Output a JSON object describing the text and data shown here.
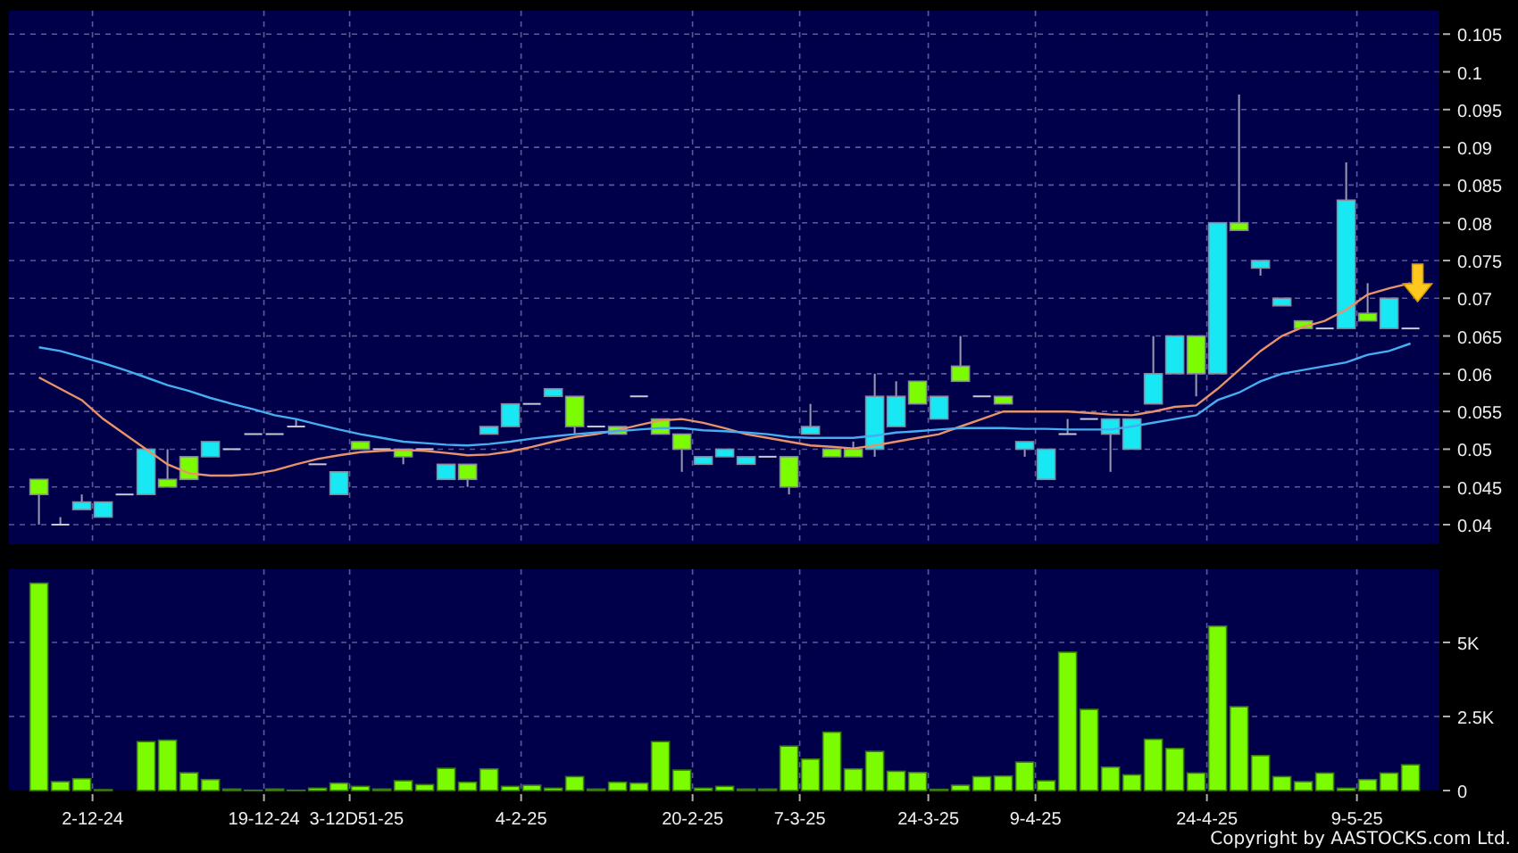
{
  "price_chart": {
    "chart_data": {
      "type": "candlestick",
      "grid": true,
      "categories": [
        null,
        null,
        null,
        null,
        null,
        null,
        null,
        null,
        null,
        null,
        null,
        null,
        null,
        null,
        null,
        null,
        null,
        null,
        null,
        null,
        null,
        null,
        null,
        null,
        null,
        null,
        null,
        null,
        null,
        null,
        null,
        null,
        null,
        null,
        null,
        null,
        null,
        null,
        null,
        null,
        null,
        null,
        null,
        null,
        null,
        null,
        null,
        null,
        null,
        null,
        null,
        null,
        null,
        null,
        null,
        null,
        null,
        null,
        null,
        null,
        null,
        null,
        null,
        null,
        null
      ],
      "ylim": [
        0.0374,
        0.1081
      ],
      "yticks": [
        0.04,
        0.045,
        0.05,
        0.055,
        0.06,
        0.065,
        0.07,
        0.075,
        0.08,
        0.085,
        0.09,
        0.095,
        0.1,
        0.105
      ],
      "series": [
        {
          "type": "line",
          "color": "#e8926a",
          "values": [
            0.0595,
            0.058,
            0.0565,
            0.054,
            0.052,
            0.05,
            0.048,
            0.0468,
            0.0465,
            0.0465,
            0.0467,
            0.0472,
            0.048,
            0.0487,
            0.0492,
            0.0496,
            0.0498,
            0.0499,
            0.0498,
            0.0495,
            0.0492,
            0.0493,
            0.0497,
            0.0503,
            0.051,
            0.0516,
            0.052,
            0.0525,
            0.0532,
            0.0538,
            0.054,
            0.0535,
            0.0528,
            0.052,
            0.0515,
            0.051,
            0.0505,
            0.0503,
            0.0501,
            0.0505,
            0.051,
            0.0515,
            0.052,
            0.053,
            0.054,
            0.055,
            0.055,
            0.055,
            0.055,
            0.0548,
            0.0546,
            0.0545,
            0.055,
            0.0556,
            0.0558,
            0.058,
            0.0605,
            0.063,
            0.065,
            0.0662,
            0.067,
            0.0685,
            0.0705,
            0.0713,
            0.072
          ]
        },
        {
          "type": "line",
          "color": "#46aef0",
          "values": [
            0.0635,
            0.063,
            0.0622,
            0.0614,
            0.0605,
            0.0595,
            0.0585,
            0.0577,
            0.0568,
            0.056,
            0.0553,
            0.0545,
            0.054,
            0.0533,
            0.0526,
            0.052,
            0.0515,
            0.051,
            0.0508,
            0.0506,
            0.0505,
            0.0507,
            0.051,
            0.0514,
            0.0517,
            0.052,
            0.0522,
            0.0524,
            0.0526,
            0.0528,
            0.0528,
            0.0525,
            0.0524,
            0.0522,
            0.052,
            0.0516,
            0.0515,
            0.0515,
            0.0515,
            0.0518,
            0.0522,
            0.0524,
            0.0526,
            0.0528,
            0.0528,
            0.0528,
            0.0527,
            0.0527,
            0.0526,
            0.0526,
            0.0526,
            0.053,
            0.0535,
            0.054,
            0.0545,
            0.0565,
            0.0575,
            0.059,
            0.06,
            0.0605,
            0.061,
            0.0615,
            0.0625,
            0.063,
            0.064
          ]
        }
      ],
      "ohlc": [
        [
          0.046,
          0.046,
          0.04,
          0.044
        ],
        [
          0.04,
          0.041,
          0.04,
          0.04
        ],
        [
          0.042,
          0.044,
          0.042,
          0.043
        ],
        [
          0.041,
          0.043,
          0.041,
          0.043
        ],
        [
          0.044,
          0.044,
          0.044,
          0.044
        ],
        [
          0.044,
          0.05,
          0.044,
          0.05
        ],
        [
          0.046,
          0.05,
          0.045,
          0.045
        ],
        [
          0.049,
          0.049,
          0.046,
          0.046
        ],
        [
          0.049,
          0.051,
          0.049,
          0.051
        ],
        [
          0.05,
          0.05,
          0.05,
          0.05
        ],
        [
          0.052,
          0.052,
          0.052,
          0.052
        ],
        [
          0.052,
          0.052,
          0.052,
          0.052
        ],
        [
          0.053,
          0.054,
          0.053,
          0.053
        ],
        [
          0.048,
          0.048,
          0.048,
          0.048
        ],
        [
          0.044,
          0.047,
          0.044,
          0.047
        ],
        [
          0.051,
          0.051,
          0.05,
          0.05
        ],
        [
          0.05,
          0.05,
          0.05,
          0.05
        ],
        [
          0.05,
          0.05,
          0.048,
          0.049
        ],
        [
          0.05,
          0.05,
          0.05,
          0.05
        ],
        [
          0.046,
          0.048,
          0.046,
          0.048
        ],
        [
          0.048,
          0.048,
          0.045,
          0.046
        ],
        [
          0.052,
          0.053,
          0.052,
          0.053
        ],
        [
          0.053,
          0.056,
          0.053,
          0.056
        ],
        [
          0.056,
          0.056,
          0.056,
          0.056
        ],
        [
          0.057,
          0.058,
          0.057,
          0.058
        ],
        [
          0.057,
          0.057,
          0.052,
          0.053
        ],
        [
          0.053,
          0.053,
          0.053,
          0.053
        ],
        [
          0.053,
          0.053,
          0.052,
          0.052
        ],
        [
          0.057,
          0.057,
          0.057,
          0.057
        ],
        [
          0.054,
          0.054,
          0.052,
          0.052
        ],
        [
          0.052,
          0.052,
          0.047,
          0.05
        ],
        [
          0.048,
          0.049,
          0.048,
          0.049
        ],
        [
          0.049,
          0.05,
          0.049,
          0.05
        ],
        [
          0.048,
          0.049,
          0.048,
          0.049
        ],
        [
          0.049,
          0.049,
          0.049,
          0.049
        ],
        [
          0.049,
          0.049,
          0.044,
          0.045
        ],
        [
          0.052,
          0.056,
          0.052,
          0.053
        ],
        [
          0.05,
          0.05,
          0.049,
          0.049
        ],
        [
          0.05,
          0.051,
          0.049,
          0.049
        ],
        [
          0.05,
          0.06,
          0.049,
          0.057
        ],
        [
          0.053,
          0.059,
          0.053,
          0.057
        ],
        [
          0.059,
          0.059,
          0.056,
          0.056
        ],
        [
          0.054,
          0.057,
          0.054,
          0.057
        ],
        [
          0.061,
          0.065,
          0.059,
          0.059
        ],
        [
          0.057,
          0.057,
          0.057,
          0.057
        ],
        [
          0.057,
          0.057,
          0.056,
          0.056
        ],
        [
          0.05,
          0.051,
          0.049,
          0.051
        ],
        [
          0.046,
          0.05,
          0.046,
          0.05
        ],
        [
          0.052,
          0.054,
          0.052,
          0.052
        ],
        [
          0.054,
          0.054,
          0.054,
          0.054
        ],
        [
          0.052,
          0.054,
          0.047,
          0.054
        ],
        [
          0.05,
          0.054,
          0.05,
          0.054
        ],
        [
          0.056,
          0.065,
          0.056,
          0.06
        ],
        [
          0.06,
          0.065,
          0.06,
          0.065
        ],
        [
          0.065,
          0.065,
          0.057,
          0.06
        ],
        [
          0.06,
          0.08,
          0.06,
          0.08
        ],
        [
          0.08,
          0.097,
          0.079,
          0.079
        ],
        [
          0.074,
          0.075,
          0.073,
          0.075
        ],
        [
          0.069,
          0.07,
          0.069,
          0.07
        ],
        [
          0.067,
          0.067,
          0.066,
          0.066
        ],
        [
          0.066,
          0.066,
          0.066,
          0.066
        ],
        [
          0.066,
          0.088,
          0.066,
          0.083
        ],
        [
          0.068,
          0.072,
          0.067,
          0.067
        ],
        [
          0.066,
          0.07,
          0.066,
          0.07
        ],
        [
          0.066,
          0.066,
          0.066,
          0.066
        ]
      ]
    }
  },
  "volume_chart": {
    "chart_data": {
      "type": "bar",
      "grid": true,
      "ylim": [
        0,
        7470
      ],
      "categories": [
        null,
        null,
        "2-12-24",
        null,
        null,
        null,
        null,
        null,
        null,
        null,
        "19-12-24",
        null,
        null,
        null,
        "3-12D51-25",
        null,
        null,
        null,
        null,
        null,
        null,
        null,
        "4-2-25",
        null,
        null,
        null,
        null,
        null,
        null,
        null,
        "20-2-25",
        null,
        null,
        null,
        null,
        "7-3-25",
        null,
        null,
        null,
        null,
        null,
        "24-3-25",
        null,
        null,
        null,
        null,
        "9-4-25",
        null,
        null,
        null,
        null,
        null,
        null,
        null,
        "24-4-25",
        null,
        null,
        null,
        null,
        null,
        null,
        "9-5-25",
        null,
        null,
        null
      ],
      "yticks": [
        {
          "value": 0,
          "label": "0"
        },
        {
          "value": 2500,
          "label": "2.5K"
        },
        {
          "value": 5000,
          "label": "5K"
        }
      ],
      "series": [
        {
          "color": "#7cfc00",
          "values": [
            7000,
            300,
            400,
            30,
            0,
            1650,
            1700,
            600,
            370,
            50,
            10,
            50,
            10,
            80,
            250,
            140,
            50,
            330,
            200,
            750,
            280,
            730,
            140,
            180,
            80,
            470,
            50,
            280,
            250,
            1650,
            690,
            80,
            140,
            50,
            50,
            1500,
            1060,
            1970,
            730,
            1320,
            650,
            610,
            40,
            180,
            470,
            490,
            960,
            330,
            4670,
            2740,
            790,
            530,
            1730,
            1420,
            590,
            5550,
            2830,
            1180,
            470,
            300,
            590,
            80,
            370,
            590,
            870
          ]
        }
      ]
    }
  },
  "copyright": "Copyright by AASTOCKS.com Ltd."
}
